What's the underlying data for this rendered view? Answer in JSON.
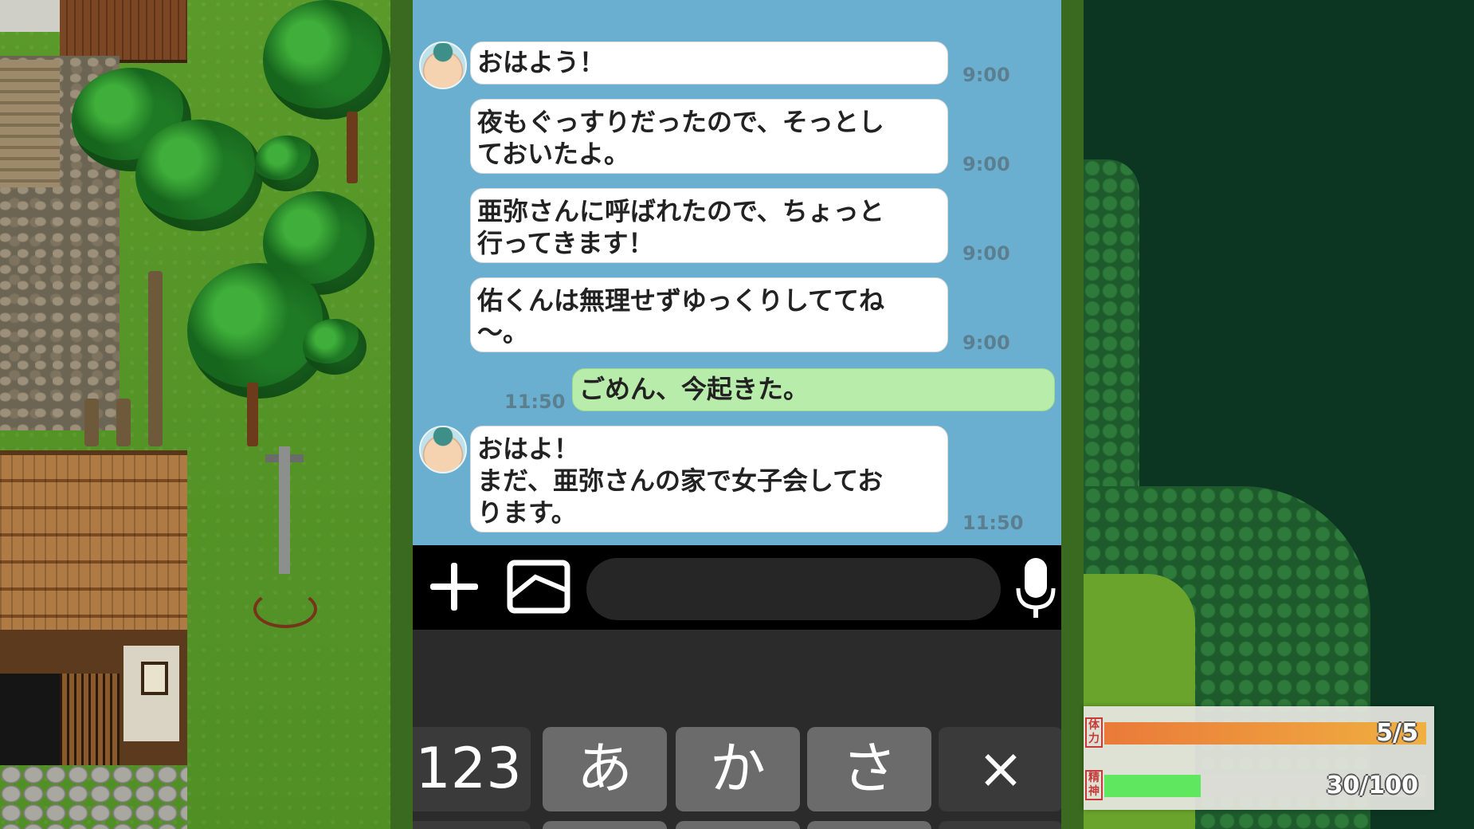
{
  "chat": {
    "messages": [
      {
        "sender": "other",
        "text": "おはよう！",
        "time": "9:00",
        "avatar": true
      },
      {
        "sender": "other",
        "text": "夜もぐっすりだったので、そっとし\nておいたよ。",
        "time": "9:00",
        "avatar": false
      },
      {
        "sender": "other",
        "text": "亜弥さんに呼ばれたので、ちょっと\n行ってきます！",
        "time": "9:00",
        "avatar": false
      },
      {
        "sender": "other",
        "text": "佑くんは無理せずゆっくりしててね\n〜。",
        "time": "9:00",
        "avatar": false
      },
      {
        "sender": "self",
        "text": "ごめん、今起きた。",
        "time": "11:50",
        "avatar": false
      },
      {
        "sender": "other",
        "text": "おはよ！\nまだ、亜弥さんの家で女子会してお\nります。",
        "time": "11:50",
        "avatar": true
      }
    ]
  },
  "input_bar": {
    "icons": [
      "plus-icon",
      "image-icon",
      "microphone-icon"
    ],
    "text_value": ""
  },
  "keyboard": {
    "keys": [
      "123",
      "あ",
      "か",
      "さ",
      "×"
    ]
  },
  "status": {
    "hp_seal": "体力",
    "hp_text": "5/5",
    "hp_fraction": 1.0,
    "mp_seal": "精神",
    "mp_text": "30/100",
    "mp_fraction": 0.3
  },
  "colors": {
    "chat_background": "#6aafcf",
    "self_bubble": "#b8ecaa",
    "hp_bar": "#ea7a3a",
    "mp_bar": "#5fe85f"
  }
}
